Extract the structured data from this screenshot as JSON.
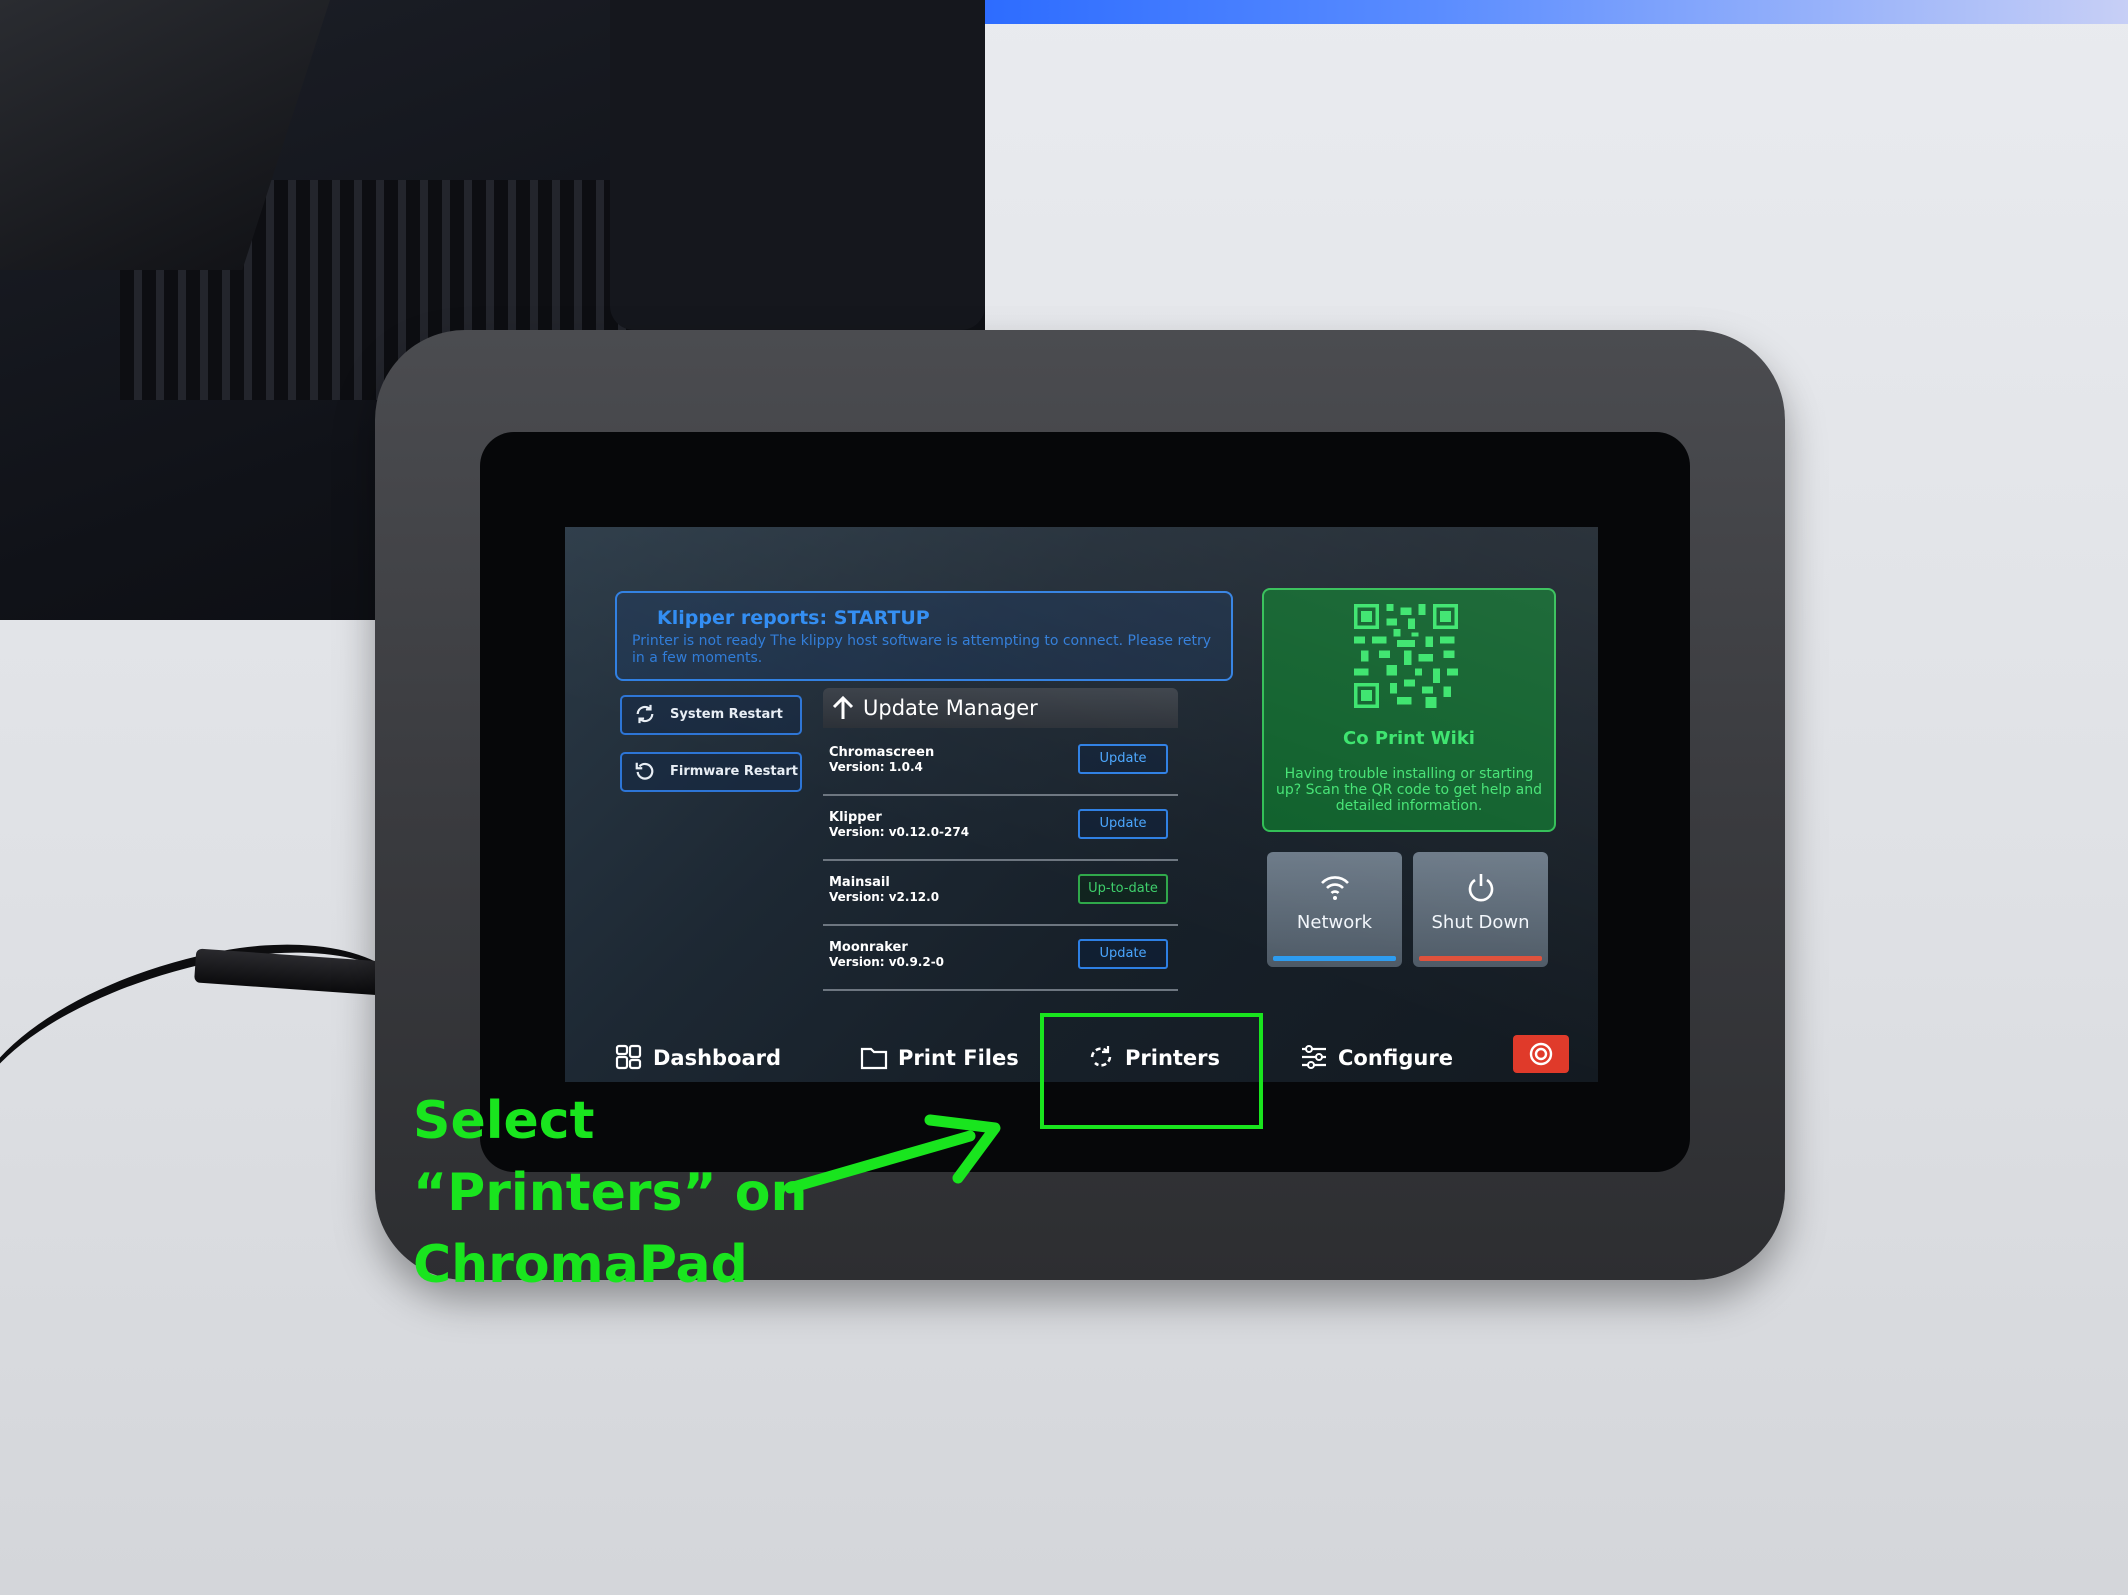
{
  "banner": {
    "title": "Klipper reports: STARTUP",
    "message": "Printer is not ready The klippy host software is attempting to connect.  Please retry in a few moments."
  },
  "actions": {
    "system_restart": "System Restart",
    "firmware_restart": "Firmware Restart"
  },
  "update_manager": {
    "title": "Update Manager",
    "rows": [
      {
        "name": "Chromascreen",
        "version": "Version: 1.0.4",
        "status": "Update"
      },
      {
        "name": "Klipper",
        "version": "Version: v0.12.0-274",
        "status": "Update"
      },
      {
        "name": "Mainsail",
        "version": "Version: v2.12.0",
        "status": "Up-to-date"
      },
      {
        "name": "Moonraker",
        "version": "Version: v0.9.2-0",
        "status": "Update"
      }
    ]
  },
  "wiki": {
    "title": "Co Print Wiki",
    "text": "Having trouble installing or starting up? Scan the QR code to get help and detailed information."
  },
  "tiles": {
    "network": "Network",
    "shutdown": "Shut Down"
  },
  "nav": {
    "dashboard": "Dashboard",
    "print_files": "Print Files",
    "printers": "Printers",
    "configure": "Configure"
  },
  "annotation": {
    "line1": "Select",
    "line2": "“Printers” on",
    "line3": "ChromaPad"
  },
  "colors": {
    "annotation_green": "#19e51e",
    "accent_blue": "#2f7fe2",
    "wiki_green": "#0d5f2a",
    "estop_red": "#e03a2a"
  }
}
